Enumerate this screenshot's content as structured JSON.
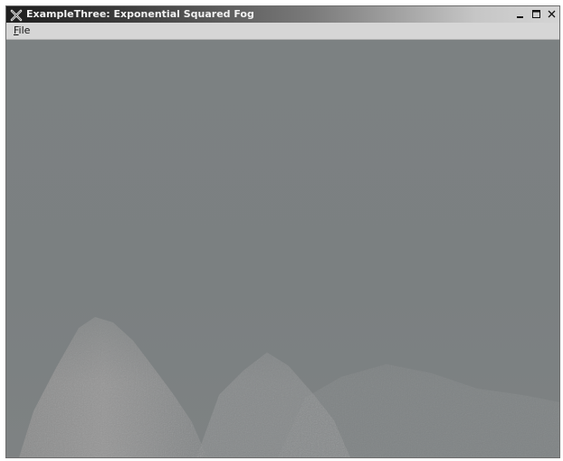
{
  "window": {
    "title": "ExampleThree: Exponential Squared Fog",
    "app_icon": "x-logo-icon",
    "controls": {
      "minimize_icon": "minimize-icon",
      "maximize_icon": "maximize-icon",
      "close_icon": "close-icon"
    }
  },
  "menubar": {
    "items": [
      {
        "label": "File",
        "mnemonic": "F",
        "rest": "ile"
      }
    ]
  },
  "scene": {
    "description_icon": "fog-terrain-render",
    "colors": {
      "fog": "#7b8081",
      "terrain": "#8d8d8d"
    }
  }
}
